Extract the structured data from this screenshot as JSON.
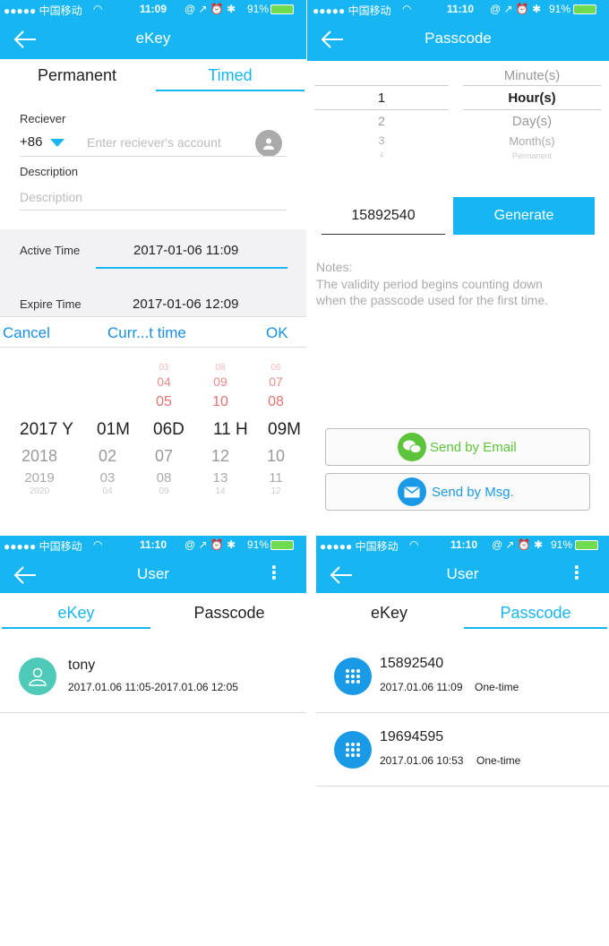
{
  "status": {
    "signal": "●●●●● 中国移动",
    "battery": "91%",
    "icons": "@ ↗ ⏰ ✱",
    "wifi_icon": "wifi-icon",
    "time_p1": "11:09",
    "time_p2": "11:10",
    "time_p3": "11:10",
    "time_p4": "11:10"
  },
  "colors": {
    "accent": "#17b6f2",
    "link": "#1a8ee6",
    "red_text": "#e57373",
    "green_text": "#6cc24a"
  },
  "panel1": {
    "title": "eKey",
    "tabs": [
      "Permanent",
      "Timed"
    ],
    "receiver_label": "Reciever",
    "country_code": "+86",
    "receiver_placeholder": "Enter reciever's account",
    "description_label": "Description",
    "description_placeholder": "Description",
    "active_label": "Active Time",
    "active_value": "2017-01-06 11:09",
    "expire_label": "Expire Time",
    "expire_value": "2017-01-06 12:09",
    "toolbar": {
      "cancel": "Cancel",
      "current": "Curr...t time",
      "ok": "OK"
    },
    "picker": {
      "years": [
        "2017",
        "2018",
        "2019",
        "2020"
      ],
      "year_unit": "Y",
      "months": [
        "01",
        "02",
        "03",
        "04"
      ],
      "month_unit": "M",
      "days_above": [
        "03",
        "04",
        "05"
      ],
      "days": [
        "06",
        "07",
        "08",
        "09"
      ],
      "day_unit": "D",
      "hours_above": [
        "08",
        "09",
        "10"
      ],
      "hours": [
        "11",
        "12",
        "13",
        "14"
      ],
      "hour_unit": "H",
      "minutes_above": [
        "06",
        "07",
        "08"
      ],
      "minutes": [
        "09",
        "10",
        "11",
        "12"
      ],
      "minute_unit": "M"
    }
  },
  "panel2": {
    "title": "Passcode",
    "numbers": [
      "1",
      "2",
      "3",
      "4"
    ],
    "units": [
      "Minute(s)",
      "Hour(s)",
      "Day(s)",
      "Month(s)",
      "Permanent"
    ],
    "passcode": "15892540",
    "generate": "Generate",
    "notes_title": "Notes:",
    "notes_line1": "The validity period begins counting down",
    "notes_line2": "when the passcode used for the first time.",
    "send_email": "Send by Email",
    "send_msg": "Send by Msg."
  },
  "panel3": {
    "title": "User",
    "tabs": [
      "eKey",
      "Passcode"
    ],
    "user_name": "tony",
    "user_period": "2017.01.06 11:05-2017.01.06 12:05"
  },
  "panel4": {
    "title": "User",
    "tabs": [
      "eKey",
      "Passcode"
    ],
    "items": [
      {
        "code": "15892540",
        "date": "2017.01.06 11:09",
        "type": "One-time"
      },
      {
        "code": "19694595",
        "date": "2017.01.06 10:53",
        "type": "One-time"
      }
    ]
  }
}
